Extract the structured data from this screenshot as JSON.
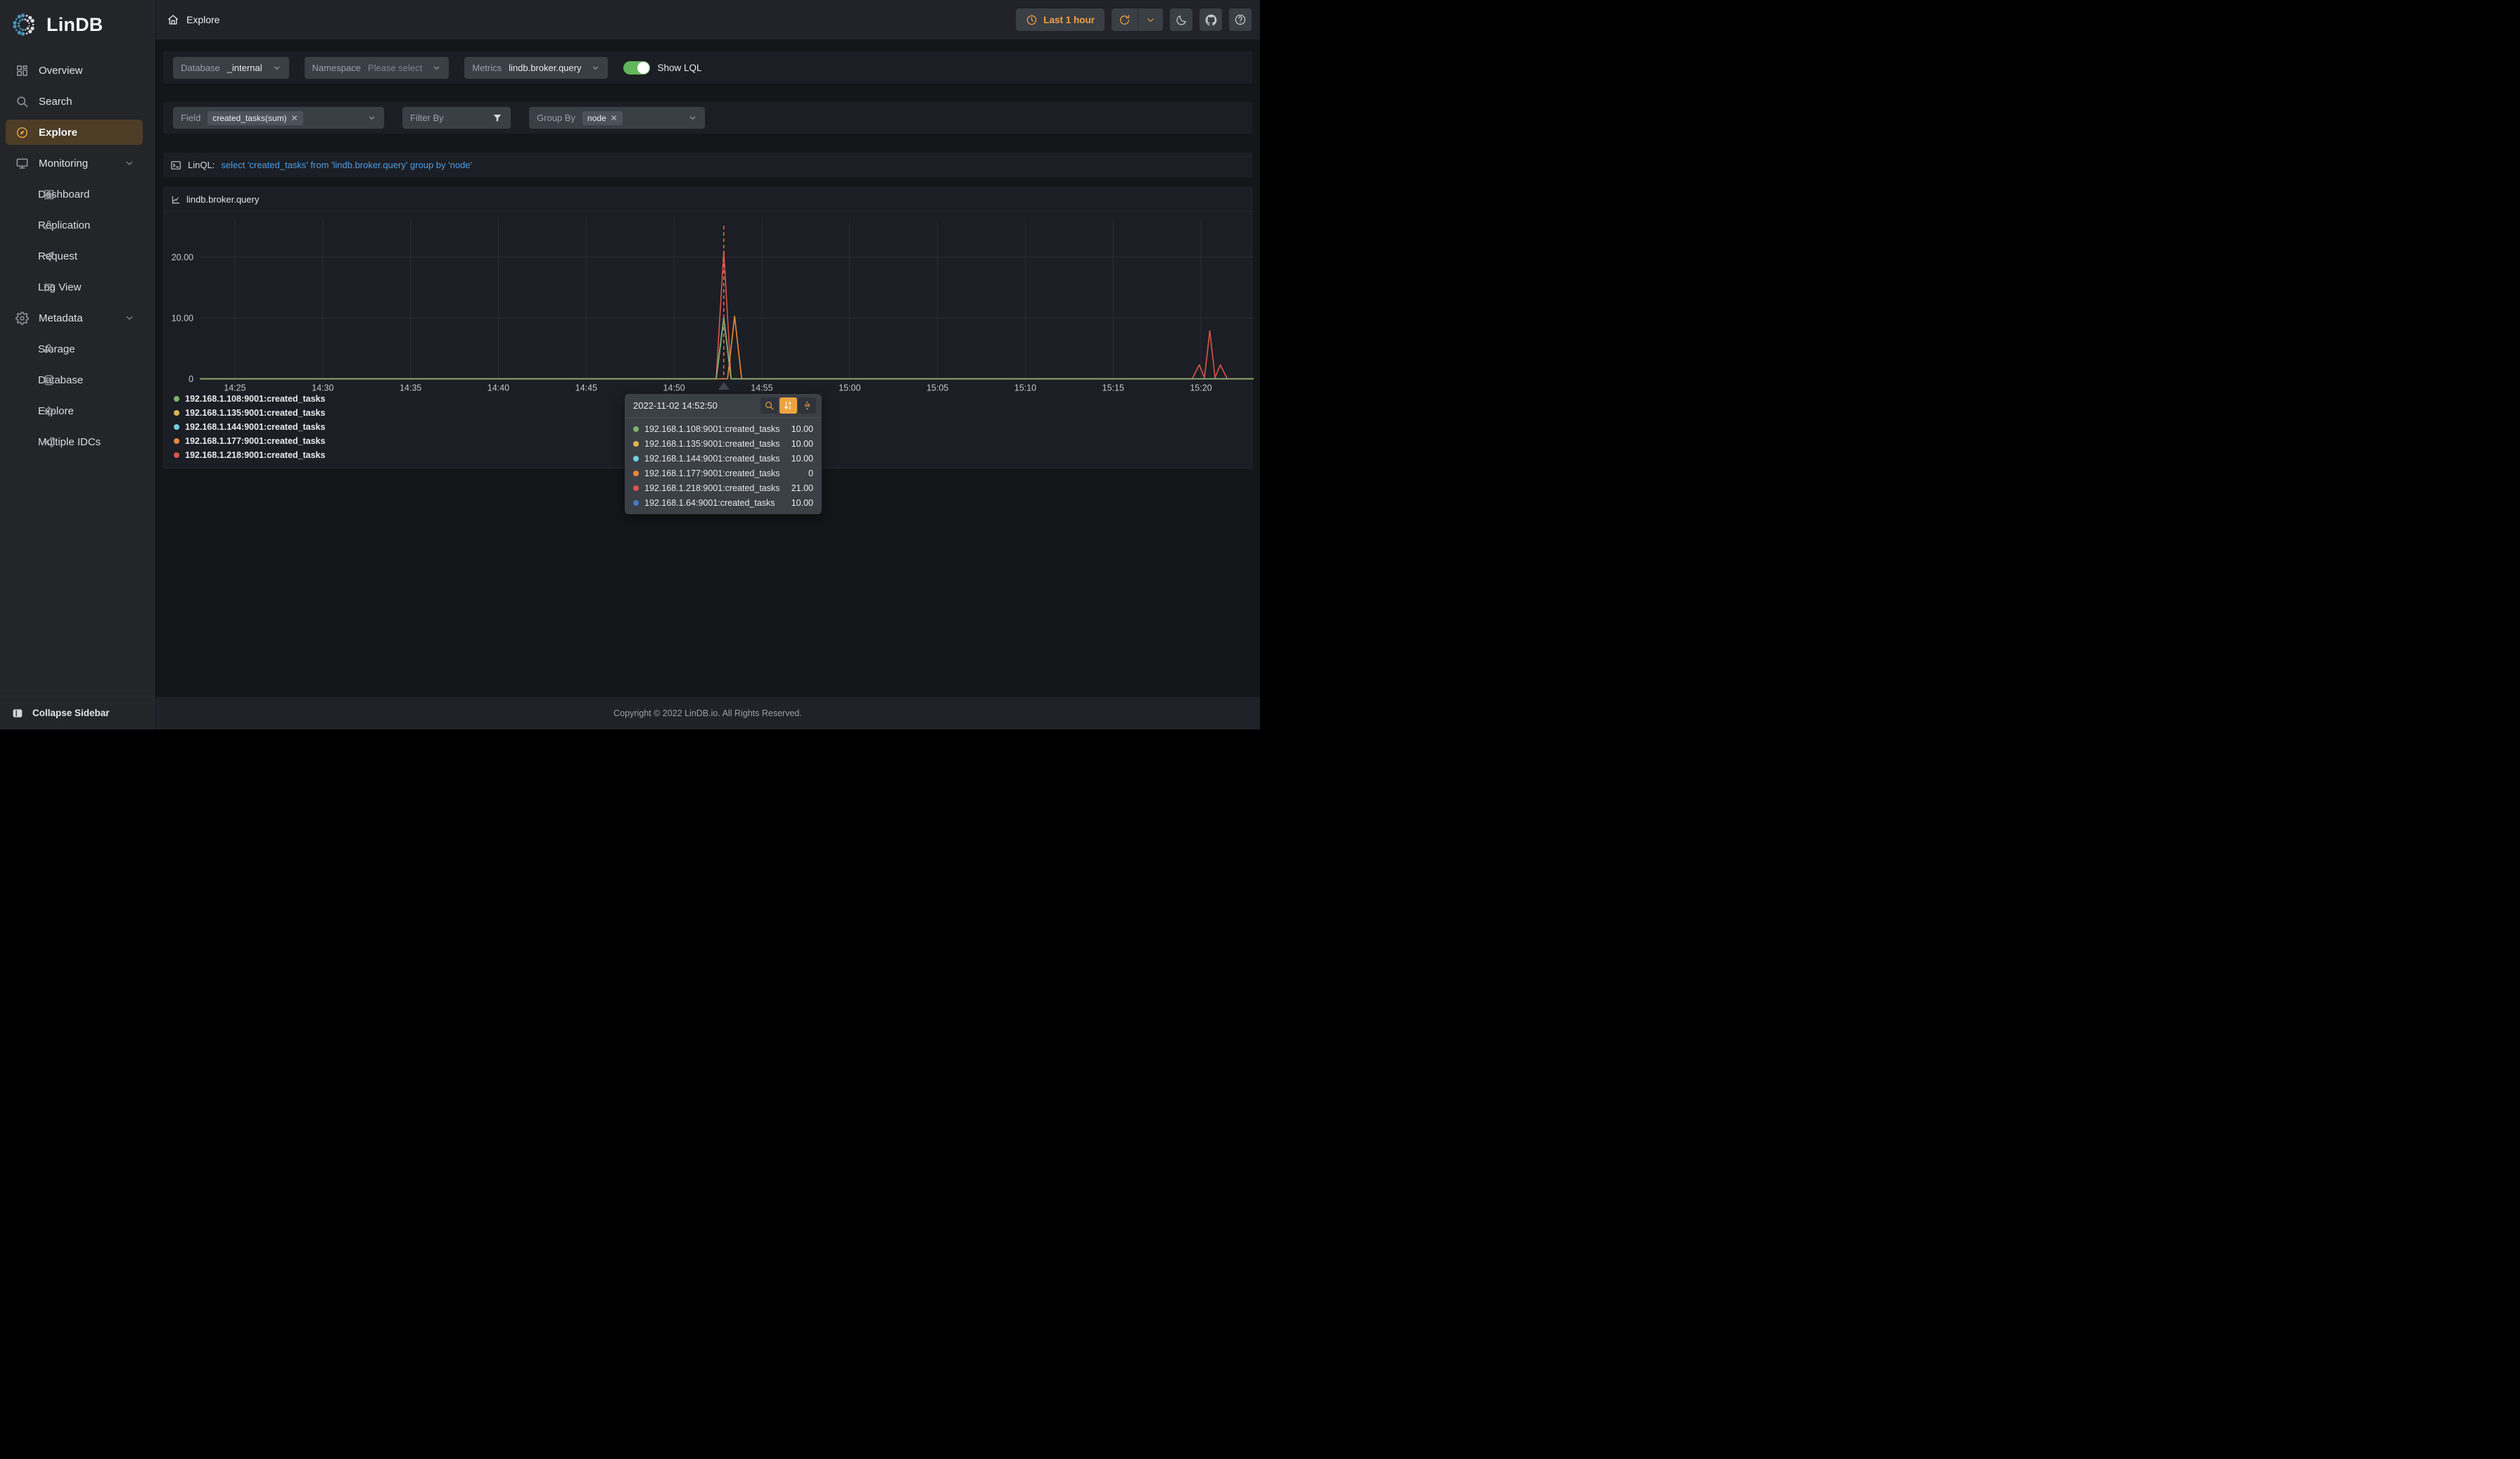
{
  "app": {
    "name": "LinDB"
  },
  "header": {
    "breadcrumb": "Explore",
    "time_button": {
      "label": "Last 1 hour",
      "icon": "clock"
    },
    "actions": [
      {
        "name": "refresh",
        "icon": "refresh"
      },
      {
        "name": "refresh-options",
        "icon": "chevron-down"
      },
      {
        "name": "theme",
        "icon": "moon"
      },
      {
        "name": "github",
        "icon": "github"
      },
      {
        "name": "help",
        "icon": "question"
      }
    ]
  },
  "sidebar": {
    "items": [
      {
        "label": "Overview",
        "icon": "overview"
      },
      {
        "label": "Search",
        "icon": "search"
      },
      {
        "label": "Explore",
        "icon": "compass",
        "active": true
      },
      {
        "label": "Monitoring",
        "icon": "monitor",
        "expandable": true
      },
      {
        "label": "Dashboard",
        "icon": "dashboard",
        "sub": true
      },
      {
        "label": "Replication",
        "icon": "replication",
        "sub": true
      },
      {
        "label": "Request",
        "icon": "request",
        "sub": true
      },
      {
        "label": "Log View",
        "icon": "logview",
        "sub": true
      },
      {
        "label": "Metadata",
        "icon": "gear",
        "expandable": true
      },
      {
        "label": "Storage",
        "icon": "storage",
        "sub": true
      },
      {
        "label": "Database",
        "icon": "database",
        "sub": true
      },
      {
        "label": "Explore",
        "icon": "target",
        "sub": true
      },
      {
        "label": "Multiple IDCs",
        "icon": "share",
        "sub": true
      }
    ],
    "collapse_label": "Collapse Sidebar"
  },
  "toolbar": {
    "database_label": "Database",
    "database_value": "_internal",
    "namespace_label": "Namespace",
    "namespace_placeholder": "Please select",
    "metrics_label": "Metrics",
    "metrics_value": "lindb.broker.query",
    "show_lql_label": "Show LQL",
    "toggle_on_color": "#62b55a"
  },
  "query_bar": {
    "field_label": "Field",
    "field_tag": "created_tasks(sum)",
    "filter_label": "Filter By",
    "group_label": "Group By",
    "group_tag": "node"
  },
  "linql": {
    "label": "LinQL:",
    "query": "select 'created_tasks' from 'lindb.broker.query' group by 'node'",
    "link_color": "#4d9ee5"
  },
  "chart_data": {
    "type": "line",
    "title": "lindb.broker.query",
    "xlabel": "",
    "ylabel": "",
    "grid": true,
    "legend_position": "bottom-left",
    "x_axis": {
      "start_minute": 0,
      "end_minute": 60,
      "ticks": [
        {
          "t": 2,
          "label": "14:25"
        },
        {
          "t": 7,
          "label": "14:30"
        },
        {
          "t": 12,
          "label": "14:35"
        },
        {
          "t": 17,
          "label": "14:40"
        },
        {
          "t": 22,
          "label": "14:45"
        },
        {
          "t": 27,
          "label": "14:50"
        },
        {
          "t": 32,
          "label": "14:55"
        },
        {
          "t": 37,
          "label": "15:00"
        },
        {
          "t": 42,
          "label": "15:05"
        },
        {
          "t": 47,
          "label": "15:10"
        },
        {
          "t": 52,
          "label": "15:15"
        },
        {
          "t": 57,
          "label": "15:20"
        }
      ]
    },
    "y_axis": {
      "min": 0,
      "max": 24.9,
      "ticks": [
        {
          "v": 0,
          "label": "0"
        },
        {
          "v": 10,
          "label": "10.00"
        },
        {
          "v": 20,
          "label": "20.00"
        }
      ]
    },
    "crosshair": {
      "t": 29.83,
      "time": "2022-11-02 14:52:50",
      "color": "#e26a4f"
    },
    "series": [
      {
        "name": "192.168.1.108:9001:created_tasks",
        "color": "#7eb26d",
        "points": [
          [
            0,
            0
          ],
          [
            29.4,
            0
          ],
          [
            29.83,
            10
          ],
          [
            30.25,
            0
          ],
          [
            60,
            0
          ]
        ]
      },
      {
        "name": "192.168.1.135:9001:created_tasks",
        "color": "#dcb64d",
        "points": [
          [
            0,
            0
          ],
          [
            29.4,
            0
          ],
          [
            29.83,
            10
          ],
          [
            30.25,
            0
          ],
          [
            60,
            0
          ]
        ]
      },
      {
        "name": "192.168.1.144:9001:created_tasks",
        "color": "#6ed0e0",
        "points": [
          [
            0,
            0
          ],
          [
            29.4,
            0
          ],
          [
            29.83,
            10
          ],
          [
            30.25,
            0
          ],
          [
            60,
            0
          ]
        ]
      },
      {
        "name": "192.168.1.177:9001:created_tasks",
        "color": "#e8883a",
        "points": [
          [
            0,
            0
          ],
          [
            30.05,
            0
          ],
          [
            30.45,
            10.3
          ],
          [
            30.85,
            0
          ],
          [
            60,
            0
          ]
        ]
      },
      {
        "name": "192.168.1.218:9001:created_tasks",
        "color": "#d9544a",
        "points": [
          [
            0,
            0
          ],
          [
            29.4,
            0
          ],
          [
            29.83,
            21
          ],
          [
            30.25,
            0
          ],
          [
            56.5,
            0
          ],
          [
            56.9,
            2.3
          ],
          [
            57.2,
            0.2
          ],
          [
            57.5,
            7.9
          ],
          [
            57.8,
            0.2
          ],
          [
            58.1,
            2.3
          ],
          [
            58.5,
            0
          ],
          [
            60,
            0
          ]
        ]
      },
      {
        "name": "192.168.1.64:9001:created_tasks",
        "color": "#4679c9",
        "points": [
          [
            0,
            0
          ],
          [
            29.4,
            0
          ],
          [
            29.83,
            10
          ],
          [
            30.25,
            0
          ],
          [
            60,
            0
          ]
        ]
      }
    ],
    "draw_order": [
      1,
      2,
      5,
      4,
      3,
      0
    ]
  },
  "legend": {
    "items": [
      {
        "label": "192.168.1.108:9001:created_tasks",
        "color": "#7eb26d"
      },
      {
        "label": "192.168.1.135:9001:created_tasks",
        "color": "#dcb64d"
      },
      {
        "label": "192.168.1.144:9001:created_tasks",
        "color": "#6ed0e0"
      },
      {
        "label": "192.168.1.177:9001:created_tasks",
        "color": "#e8883a"
      },
      {
        "label": "192.168.1.218:9001:created_tasks",
        "color": "#d9544a"
      }
    ]
  },
  "tooltip": {
    "timestamp": "2022-11-02 14:52:50",
    "buttons": [
      {
        "name": "search-series",
        "icon": "magnifier",
        "active": false
      },
      {
        "name": "sort-alpha",
        "icon": "sort-az",
        "active": true
      },
      {
        "name": "sort-value",
        "icon": "sort-09",
        "active": false
      }
    ],
    "rows": [
      {
        "name": "192.168.1.108:9001:created_tasks",
        "color": "#7eb26d",
        "value": "10.00"
      },
      {
        "name": "192.168.1.135:9001:created_tasks",
        "color": "#dcb64d",
        "value": "10.00"
      },
      {
        "name": "192.168.1.144:9001:created_tasks",
        "color": "#6ed0e0",
        "value": "10.00"
      },
      {
        "name": "192.168.1.177:9001:created_tasks",
        "color": "#e8883a",
        "value": "0"
      },
      {
        "name": "192.168.1.218:9001:created_tasks",
        "color": "#d9544a",
        "value": "21.00"
      },
      {
        "name": "192.168.1.64:9001:created_tasks",
        "color": "#4679c9",
        "value": "10.00"
      }
    ]
  },
  "footer": {
    "copyright": "Copyright © 2022 LinDB.io. All Rights Reserved."
  }
}
